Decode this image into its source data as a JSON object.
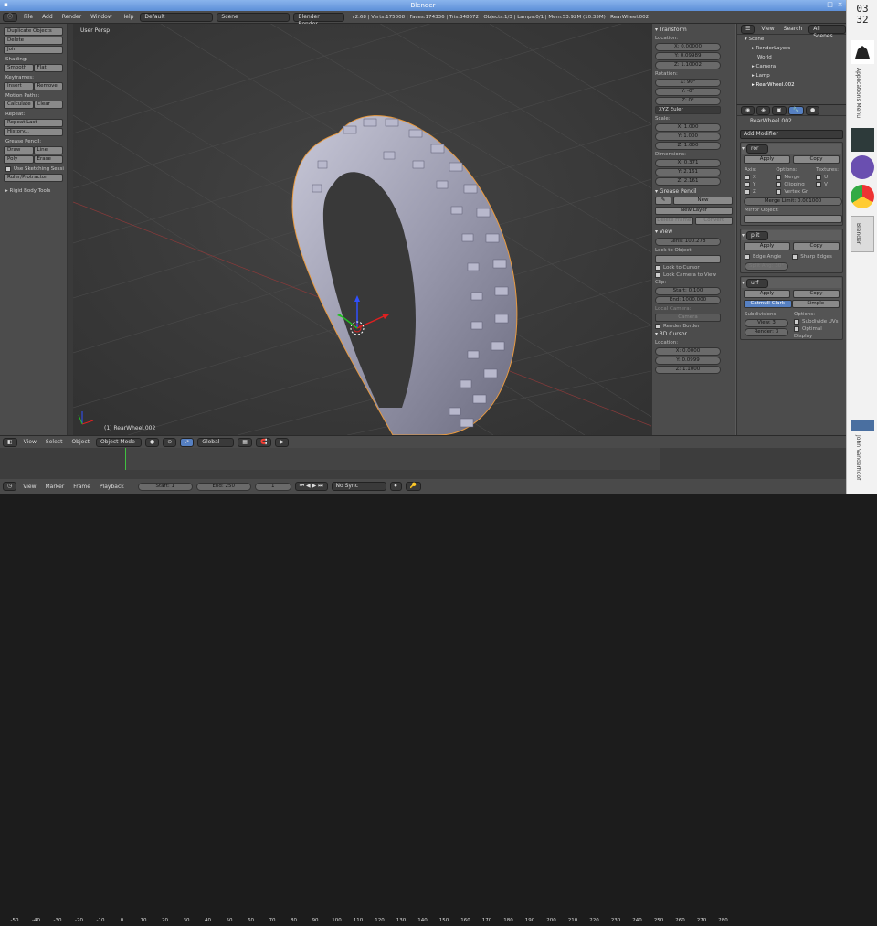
{
  "window": {
    "title": "Blender"
  },
  "infobar": {
    "menus": [
      "File",
      "Add",
      "Render",
      "Window",
      "Help"
    ],
    "layout": "Default",
    "scene": "Scene",
    "engine": "Blender Render",
    "stats": "v2.68 | Verts:175008 | Faces:174336 | Tris:348672 | Objects:1/3 | Lamps:0/1 | Mem:53.92M (10.35M) | RearWheel.002"
  },
  "toolshelf": {
    "top_buttons": [
      "Duplicate Objects",
      "Delete",
      "Join"
    ],
    "shading_label": "Shading:",
    "shading": [
      "Smooth",
      "Flat"
    ],
    "keyframes_label": "Keyframes:",
    "keyframes": [
      "Insert",
      "Remove"
    ],
    "motion_label": "Motion Paths:",
    "motion": [
      "Calculate",
      "Clear"
    ],
    "repeat_label": "Repeat:",
    "repeat": [
      "Repeat Last",
      "History..."
    ],
    "grease_label": "Grease Pencil:",
    "grease1": [
      "Draw",
      "Line"
    ],
    "grease2": [
      "Poly",
      "Erase"
    ],
    "sketching": "Use Sketching Sessi",
    "ruler": "Ruler/Protractor",
    "rigid": "Rigid Body Tools"
  },
  "viewport": {
    "label": "User Persp",
    "object": "(1) RearWheel.002"
  },
  "npanel": {
    "transform": "Transform",
    "location": "Location:",
    "loc": [
      "X: 0.00000",
      "Y: 0.09989",
      "Z: 1.10002"
    ],
    "rotation": "Rotation:",
    "rot": [
      "X: 90°",
      "Y: -0°",
      "Z: 0°"
    ],
    "euler": "XYZ Euler",
    "scale": "Scale:",
    "scl": [
      "X: 1.000",
      "Y: 1.000",
      "Z: 1.000"
    ],
    "dimensions": "Dimensions:",
    "dim": [
      "X: 0.371",
      "Y: 2.161",
      "Z: 2.161"
    ],
    "grease": "Grease Pencil",
    "new": "New",
    "new_layer": "New Layer",
    "delete_frame": "Delete Frame",
    "convert": "Convert",
    "view": "View",
    "lens": "Lens: 100.278",
    "lock_obj": "Lock to Object:",
    "lock_cursor": "Lock to Cursor",
    "lock_cam": "Lock Camera to View",
    "clip": "Clip:",
    "clip_start": "Start: 0.100",
    "clip_end": "End: 1000.000",
    "local_camera": "Local Camera:",
    "camera": "Camera",
    "render_border": "Render Border",
    "cursor": "3D Cursor",
    "cursor_loc": "Location:",
    "cur": [
      "X: 0.0000",
      "Y: 0.0999",
      "Z: 1.1000"
    ]
  },
  "outliner": {
    "view": "View",
    "search": "Search",
    "scenes": "All Scenes",
    "items": [
      "Scene",
      "RenderLayers",
      "World",
      "Camera",
      "Lamp",
      "RearWheel.002"
    ]
  },
  "props": {
    "object": "RearWheel.002",
    "add_modifier": "Add Modifier",
    "mirror": {
      "name": "ror",
      "apply": "Apply",
      "copy": "Copy",
      "axis": "Axis:",
      "options": "Options:",
      "textures": "Textures:",
      "x": "X",
      "y": "Y",
      "z": "Z",
      "merge": "Merge",
      "clipping": "Clipping",
      "vgr": "Vertex Gr",
      "u": "U",
      "v": "V",
      "merge_limit": "Merge Limit: 0.001000",
      "mirror_obj": "Mirror Object:"
    },
    "split": {
      "name": "plit",
      "apply": "Apply",
      "copy": "Copy",
      "edge_angle": "Edge Angle",
      "sharp": "Sharp Edges",
      "split_angle": "Split Ang: 30°"
    },
    "subsurf": {
      "name": "urf",
      "apply": "Apply",
      "copy": "Copy",
      "catmull": "Catmull-Clark",
      "simple": "Simple",
      "subdivisions": "Subdivisions:",
      "options": "Options:",
      "view": "View: 3",
      "render": "Render: 3",
      "uvs": "Subdivide UVs",
      "optimal": "Optimal Display"
    }
  },
  "vheader": {
    "menus": [
      "View",
      "Select",
      "Object"
    ],
    "mode": "Object Mode",
    "orient": "Global"
  },
  "timeline": {
    "ticks": [
      "-50",
      "-40",
      "-30",
      "-20",
      "-10",
      "0",
      "10",
      "20",
      "30",
      "40",
      "50",
      "60",
      "70",
      "80",
      "90",
      "100",
      "110",
      "120",
      "130",
      "140",
      "150",
      "160",
      "170",
      "180",
      "190",
      "200",
      "210",
      "220",
      "230",
      "240",
      "250",
      "260",
      "270",
      "280"
    ],
    "menus": [
      "View",
      "Marker",
      "Frame",
      "Playback"
    ],
    "start": "Start: 1",
    "end": "End: 250",
    "current": "1",
    "sync": "No Sync"
  },
  "taskbar": {
    "clock_h": "03",
    "clock_m": "32",
    "apps_label": "Applications Menu",
    "blender_label": "Blender",
    "user": "John Vanderhoof"
  },
  "colors": {
    "accent": "#5680c2",
    "selection": "#f0a040"
  }
}
